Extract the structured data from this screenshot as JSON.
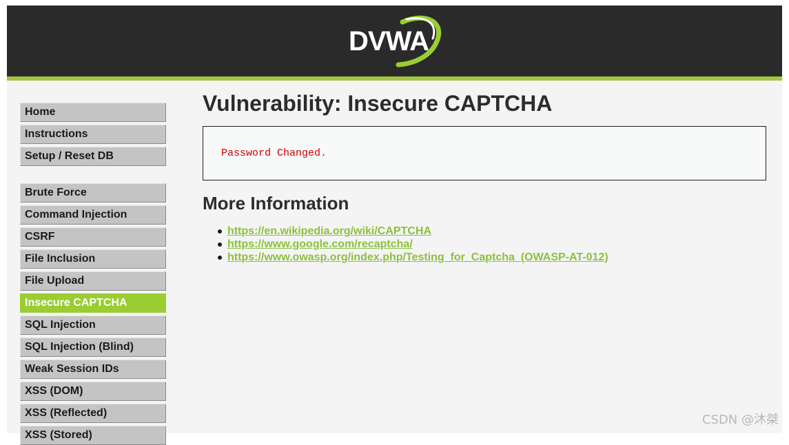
{
  "header": {
    "logo_text": "DVWA"
  },
  "nav": {
    "group1": [
      "Home",
      "Instructions",
      "Setup / Reset DB"
    ],
    "group2": [
      "Brute Force",
      "Command Injection",
      "CSRF",
      "File Inclusion",
      "File Upload",
      "Insecure CAPTCHA",
      "SQL Injection",
      "SQL Injection (Blind)",
      "Weak Session IDs",
      "XSS (DOM)",
      "XSS (Reflected)",
      "XSS (Stored)"
    ],
    "selected": "Insecure CAPTCHA"
  },
  "main": {
    "title": "Vulnerability: Insecure CAPTCHA",
    "result_message": "Password Changed.",
    "more_info_heading": "More Information",
    "links": [
      "https://en.wikipedia.org/wiki/CAPTCHA",
      "https://www.google.com/recaptcha/",
      "https://www.owasp.org/index.php/Testing_for_Captcha_(OWASP-AT-012)"
    ]
  },
  "watermark": "CSDN @沐桀",
  "colors": {
    "accent": "#9acd32",
    "header_bg": "#2a2a2a",
    "error_text": "#cc0000",
    "link": "#8cc13d"
  }
}
